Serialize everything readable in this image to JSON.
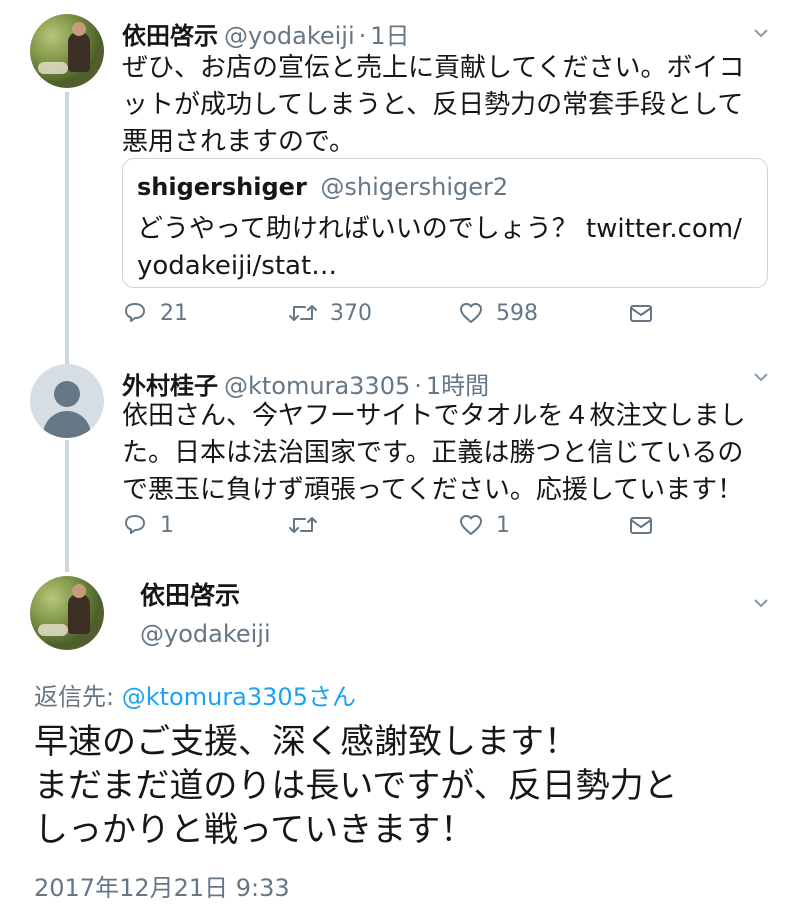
{
  "tweets": [
    {
      "name": "依田啓示",
      "handle": "@yodakeiji",
      "time": "1日",
      "text_lines": [
        "ぜひ、お店の宣伝と売上に貢献してください。ボイコ",
        "ットが成功してしまうと、反日勢力の常套手段として",
        "悪用されますので。"
      ],
      "quote": {
        "name": "shigershiger",
        "handle": "@shigershiger2",
        "text_lines": [
          "どうやって助ければいいのでしょう？ twitter.com/",
          "yodakeiji/stat…"
        ]
      },
      "replies": "21",
      "retweets": "370",
      "likes": "598",
      "avatar_icon": "avatar-photo"
    },
    {
      "name": "外村桂子",
      "handle": "@ktomura3305",
      "time": "1時間",
      "text_lines": [
        "依田さん、今ヤフーサイトでタオルを４枚注文しまし",
        "た。日本は法治国家です。正義は勝つと信じているの",
        "で悪玉に負けず頑張ってください。応援しています！"
      ],
      "replies": "1",
      "retweets": "",
      "likes": "1",
      "avatar_icon": "default-avatar"
    }
  ],
  "focused": {
    "name": "依田啓示",
    "handle": "@yodakeiji",
    "reply_prefix": "返信先:",
    "reply_handle": "@ktomura3305さん",
    "text_lines": [
      "早速のご支援、深く感謝致します！",
      "まだまだ道のりは長いですが、反日勢力と",
      "しっかりと戦っていきます！"
    ],
    "timestamp": "2017年12月21日 9:33"
  },
  "colors": {
    "link": "#1da1f2",
    "secondary": "#657786",
    "thread_line": "#ccd6dd",
    "text": "#14171a"
  },
  "icons": {
    "reply": "reply-icon",
    "retweet": "retweet-icon",
    "like": "heart-icon",
    "dm": "envelope-icon",
    "menu": "chevron-down-icon"
  }
}
